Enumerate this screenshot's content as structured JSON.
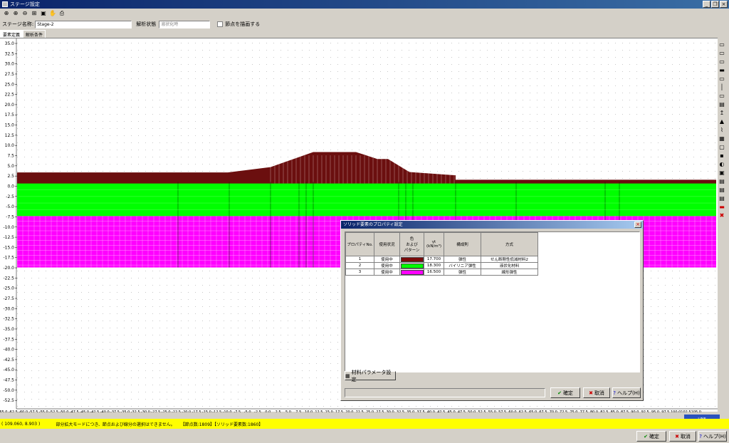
{
  "window": {
    "title": "ステージ設定",
    "minimize": "_",
    "restore": "❐",
    "close": "×"
  },
  "toolbar": {
    "icons": [
      "zoom-fit-icon",
      "zoom-in-icon",
      "zoom-out-icon",
      "grid-zoom-icon",
      "window-zoom-icon",
      "pan-hand-icon",
      "print-icon"
    ]
  },
  "stage": {
    "name_label": "ステージ名称",
    "name_value": "Stage-2",
    "analysis_label": "解析状態",
    "analysis_value": "液状化時",
    "node_draw_label": "節点を描画する"
  },
  "tabs": [
    "要素定義",
    "解析条件"
  ],
  "y_ticks": [
    "35.0",
    "32.5",
    "30.0",
    "27.5",
    "25.0",
    "22.5",
    "20.0",
    "17.5",
    "15.0",
    "12.5",
    "10.0",
    "7.5",
    "5.0",
    "2.5",
    "0.0",
    "-2.5",
    "-5.0",
    "-7.5",
    "-10.0",
    "-12.5",
    "-15.0",
    "-17.5",
    "-20.0",
    "-22.5",
    "-25.0",
    "-27.5",
    "-30.0",
    "-32.5",
    "-35.0",
    "-37.5",
    "-40.0",
    "-42.5",
    "-45.0",
    "-47.5",
    "-50.0",
    "-52.5"
  ],
  "x_ticks": [
    "-65.0",
    "-62.5",
    "-60.0",
    "-57.5",
    "-55.0",
    "-52.5",
    "-50.0",
    "-47.5",
    "-45.0",
    "-42.5",
    "-40.0",
    "-37.5",
    "-35.0",
    "-32.5",
    "-30.0",
    "-27.5",
    "-25.0",
    "-22.5",
    "-20.0",
    "-17.5",
    "-15.0",
    "-12.5",
    "-10.0",
    "-7.5",
    "-5.0",
    "-2.5",
    "0.0",
    "2.5",
    "5.0",
    "7.5",
    "10.0",
    "12.5",
    "15.0",
    "17.5",
    "20.0",
    "22.5",
    "25.0",
    "27.5",
    "30.0",
    "32.5",
    "35.0",
    "37.5",
    "40.0",
    "42.5",
    "45.0",
    "47.5",
    "50.0",
    "52.5",
    "55.0",
    "57.5",
    "60.0",
    "62.5",
    "65.0",
    "67.5",
    "70.0",
    "72.5",
    "75.0",
    "77.5",
    "80.0",
    "82.5",
    "85.0",
    "87.5",
    "90.0",
    "92.5",
    "95.0",
    "97.5",
    "100.0",
    "102.5",
    "105.0"
  ],
  "colors": {
    "embankment": "#6b0f0f",
    "layer2": "#00ff00",
    "layer3": "#ff00ff",
    "status": "#ffff00"
  },
  "right_tools": [
    "node-add-icon",
    "node-move-icon",
    "node-delete-icon",
    "element-add-icon",
    "element-divide-icon",
    "element-delete-icon",
    "line-icon",
    "boundary-icon",
    "water-level-icon",
    "load-icon",
    "spring-icon",
    "fixed-icon",
    "solid-icon",
    "beam-icon",
    "joint-icon",
    "truss-icon",
    "material-icon",
    "layer-icon",
    "property-icon",
    "delete-icon",
    "check-icon"
  ],
  "status": {
    "coords": "( 109.060,  8.903 )",
    "message": "部分拡大モードにつき、節点および線分の選択はできません。",
    "counts": "【節点数:1809】【ソリッド要素数:1860】",
    "mode": "LINE"
  },
  "dialog": {
    "title": "ソリッド要素のプロパティ設定",
    "headers": [
      "プロパティNo.",
      "使用状況",
      "色\nおよび\nパターン",
      "γt\n(kN/m³)",
      "構成則",
      "方式"
    ],
    "rows": [
      {
        "no": "1",
        "status": "使用中",
        "color": "#7a0a0a",
        "gamma": "17.700",
        "law": "弾性",
        "method": "せん断剛性低減材料2"
      },
      {
        "no": "2",
        "status": "使用中",
        "color": "#00ff00",
        "gamma": "18.300",
        "law": "バイリニア弾性",
        "method": "液状化材料"
      },
      {
        "no": "3",
        "status": "使用中",
        "color": "#ff00ff",
        "gamma": "16.500",
        "law": "弾性",
        "method": "線形弾性"
      }
    ],
    "material_button": "材料パラメータ設定",
    "ok": "確定",
    "cancel": "取消",
    "help": "ヘルプ(H)"
  },
  "bottom": {
    "ok": "確定",
    "cancel": "取消",
    "help": "ヘルプ(H)"
  }
}
